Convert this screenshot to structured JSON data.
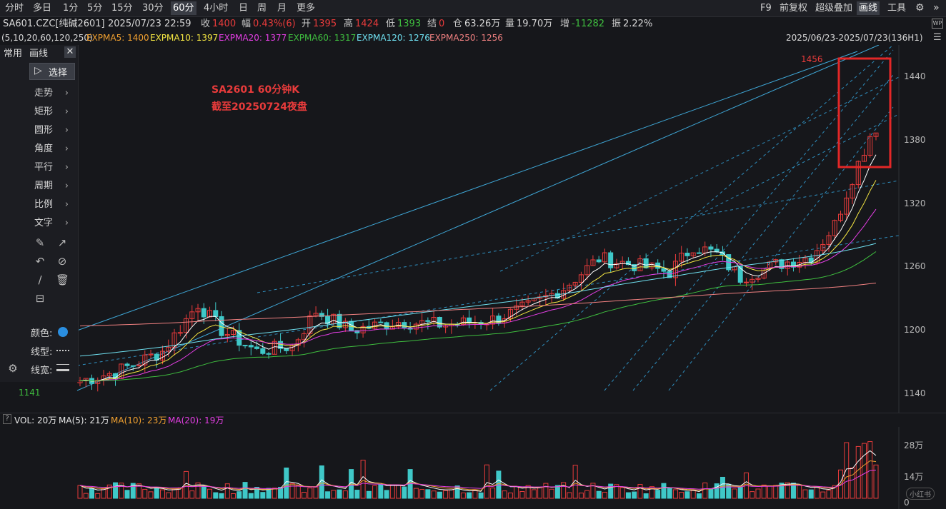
{
  "toolbar": {
    "periods": [
      "分时",
      "多日",
      "1分",
      "5分",
      "15分",
      "30分",
      "60分",
      "4小时",
      "日",
      "周",
      "月",
      "更多"
    ],
    "active_period": "60分",
    "f9": "F9",
    "adjust": "前复权",
    "overlay": "超级叠加",
    "draw": "画线",
    "tools": "工具"
  },
  "quote": {
    "symbol": "SA601.CZC[纯碱2601]",
    "datetime": "2025/07/23 22:59",
    "close_label": "收",
    "close": "1400",
    "change_label": "幅",
    "change": "0.43%(6)",
    "open_label": "开",
    "open": "1395",
    "high_label": "高",
    "high": "1424",
    "low_label": "低",
    "low": "1393",
    "settle_label": "结",
    "settle": "0",
    "oi_label": "仓",
    "oi": "63.26万",
    "vol_label": "量",
    "vol": "19.70万",
    "inc_label": "增",
    "inc": "-11282",
    "amp_label": "振",
    "amp": "2.22%"
  },
  "ma_bar": {
    "params": "(5,10,20,60,120,250)",
    "items": [
      {
        "label": "EXPMA5: 1400",
        "color": "#ffffff"
      },
      {
        "label": "EXPMA10: 1397",
        "color": "#f5e742"
      },
      {
        "label": "EXPMA20: 1377",
        "color": "#e43ee4"
      },
      {
        "label": "EXPMA60: 1317",
        "color": "#3fbf3f"
      },
      {
        "label": "EXPMA120: 1276",
        "color": "#6fe0f0"
      },
      {
        "label": "EXPMA250: 1256",
        "color": "#f08080"
      }
    ],
    "range": "2025/06/23-2025/07/23(136H1)"
  },
  "left_panel": {
    "tab_common": "常用",
    "tab_draw": "画线",
    "select": "选择",
    "items": [
      "走势",
      "矩形",
      "圆形",
      "角度",
      "平行",
      "周期",
      "比例",
      "文字"
    ],
    "color_label": "颜色:",
    "linetype_label": "线型:",
    "linewidth_label": "线宽:"
  },
  "annotation": {
    "line1": "SA2601 60分钟K",
    "line2": "截至20250724夜盘"
  },
  "price_axis": {
    "ticks": [
      "1440",
      "1380",
      "1320",
      "1260",
      "1200",
      "1140"
    ],
    "high_mark": "1456",
    "low_mark": "1141"
  },
  "volume_bar": {
    "q": "?",
    "items": [
      {
        "label": "VOL: 20万",
        "color": "#e8e8e8"
      },
      {
        "label": "MA(5): 21万",
        "color": "#e8e8e8"
      },
      {
        "label": "MA(10): 23万",
        "color": "#f0a030"
      },
      {
        "label": "MA(20): 19万",
        "color": "#e43ee4"
      }
    ],
    "ticks": [
      "28万",
      "14万",
      "0"
    ]
  },
  "watermark": "小红书",
  "colors": {
    "up": "#e83b3b",
    "down": "#3fc8c8",
    "bg": "#16171b"
  }
}
